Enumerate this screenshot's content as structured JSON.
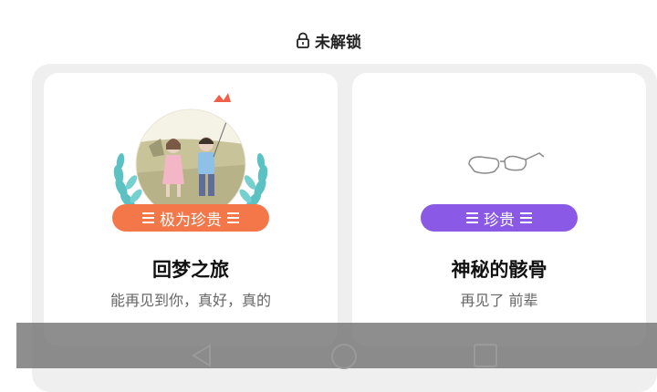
{
  "header": {
    "status_label": "未解锁",
    "icon": "lock-icon"
  },
  "cards": [
    {
      "badge": "极为珍贵",
      "title": "回梦之旅",
      "subtitle": "能再见到你，真好，真的",
      "badge_color": "#f4774a",
      "image": "couple-illustration"
    },
    {
      "badge": "珍贵",
      "title": "神秘的骸骨",
      "subtitle": "再见了 前辈",
      "badge_color": "#8a5ae6",
      "image": "glasses-illustration"
    }
  ],
  "navbar": {
    "buttons": [
      "back-icon",
      "home-icon",
      "recents-icon"
    ]
  }
}
